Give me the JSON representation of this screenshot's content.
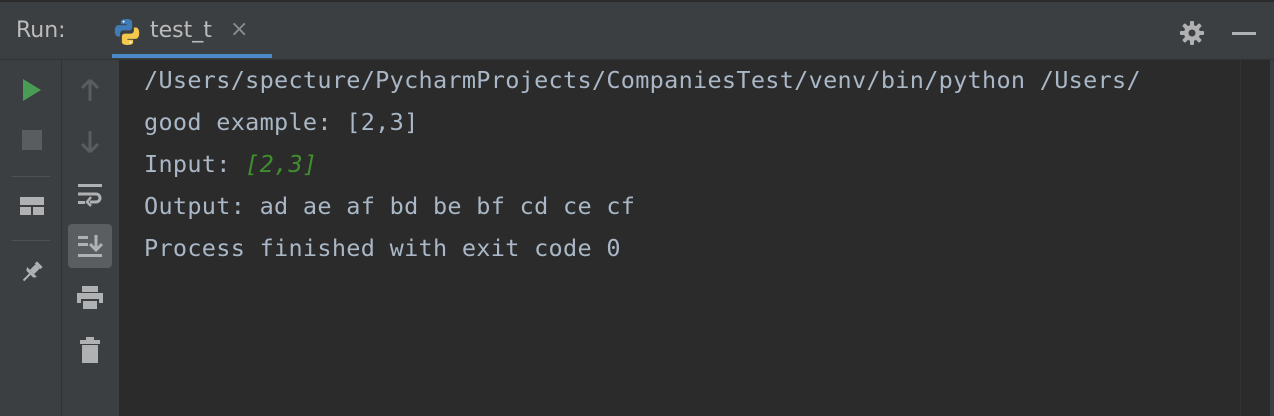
{
  "header": {
    "run_label": "Run:",
    "tab": {
      "label": "test_t",
      "close_glyph": "×",
      "icon": "python-icon"
    },
    "accent_color": "#4a88c7"
  },
  "toolbar_left": [
    {
      "name": "run-icon",
      "color": "#499c54"
    },
    {
      "name": "stop-icon",
      "disabled": true
    },
    {
      "name": "layout-icon"
    },
    {
      "name": "pin-icon"
    }
  ],
  "toolbar_right": [
    {
      "name": "up-arrow-icon",
      "disabled": true
    },
    {
      "name": "down-arrow-icon",
      "disabled": true
    },
    {
      "name": "soft-wrap-icon"
    },
    {
      "name": "scroll-to-end-icon",
      "active": true
    },
    {
      "name": "print-icon"
    },
    {
      "name": "trash-icon"
    }
  ],
  "console": {
    "lines": {
      "cmd": "/Users/specture/PycharmProjects/CompaniesTest/venv/bin/python /Users/",
      "example": "good example: [2,3]",
      "input_label": "Input: ",
      "input_value": "[2,3]",
      "output": "Output: ad ae af bd be bf cd ce cf",
      "finished": "Process finished with exit code 0"
    },
    "input_value_color": "#3f8f2f"
  }
}
